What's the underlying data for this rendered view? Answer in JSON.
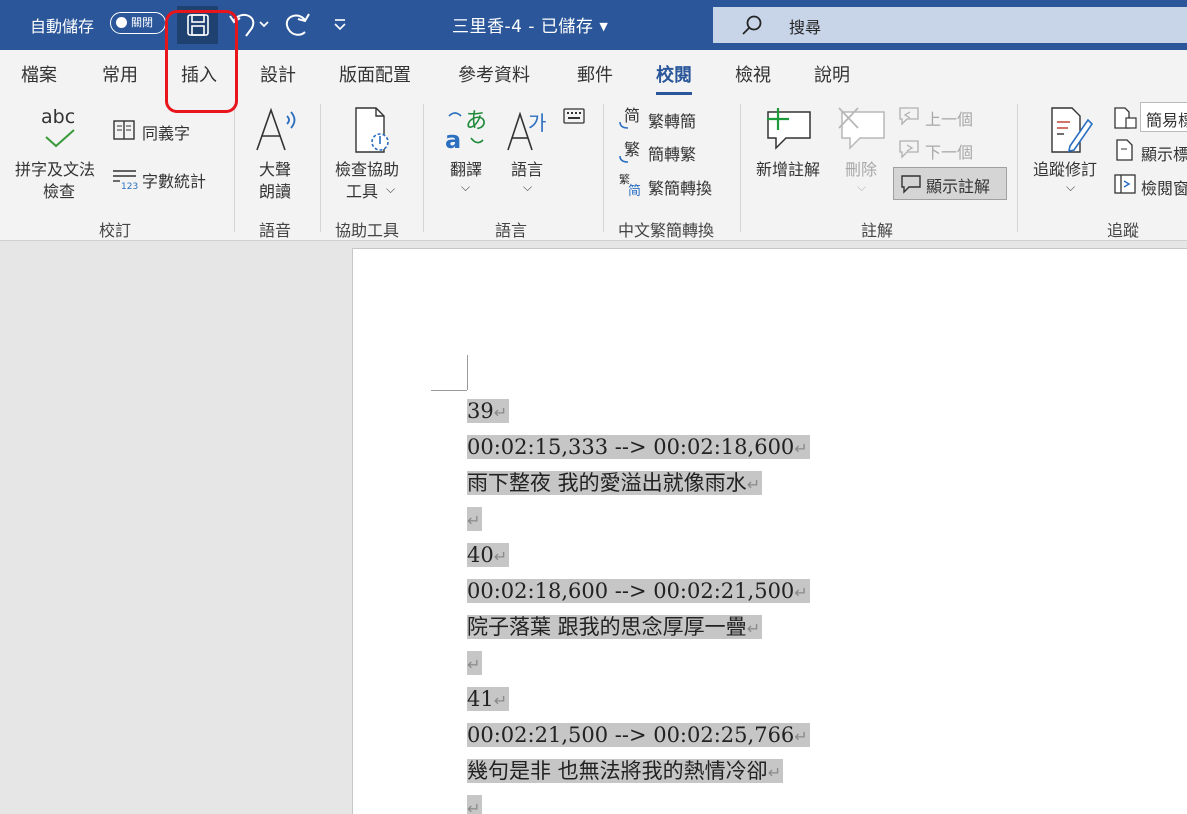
{
  "titlebar": {
    "autosave_label": "自動儲存",
    "autosave_state": "關閉",
    "doc_title": "三里香-4 - 已儲存",
    "search_placeholder": "搜尋"
  },
  "tabs": [
    {
      "label": "檔案"
    },
    {
      "label": "常用"
    },
    {
      "label": "插入"
    },
    {
      "label": "設計"
    },
    {
      "label": "版面配置"
    },
    {
      "label": "參考資料"
    },
    {
      "label": "郵件"
    },
    {
      "label": "校閱",
      "active": true
    },
    {
      "label": "檢視"
    },
    {
      "label": "說明"
    }
  ],
  "ribbon": {
    "proofing": {
      "spelling_line1": "拼字及文法",
      "spelling_line2": "檢查",
      "thesaurus": "同義字",
      "wordcount": "字數統計",
      "group": "校訂",
      "abc": "abc"
    },
    "speech": {
      "read_line1": "大聲",
      "read_line2": "朗讀",
      "group": "語音"
    },
    "accessibility": {
      "check_line1": "檢查協助",
      "check_line2": "工具",
      "group": "協助工具"
    },
    "language": {
      "translate": "翻譯",
      "language": "語言",
      "group": "語言"
    },
    "chinese": {
      "to_simplified": "繁轉簡",
      "to_traditional": "簡轉繁",
      "convert": "繁簡轉換",
      "group": "中文繁簡轉換"
    },
    "comments": {
      "new": "新增註解",
      "delete": "刪除",
      "previous": "上一個",
      "next": "下一個",
      "show": "顯示註解",
      "group": "註解"
    },
    "tracking": {
      "track": "追蹤修訂",
      "markup": "簡易標",
      "show_markup": "顯示標",
      "reviewing_pane": "檢閱窗",
      "group": "追蹤"
    }
  },
  "document": {
    "lines": [
      {
        "text": "39",
        "kind": "num"
      },
      {
        "text": "00:02:15,333 --> 00:02:18,600",
        "kind": "time"
      },
      {
        "text": "雨下整夜 我的愛溢出就像雨水",
        "kind": "lyric"
      },
      {
        "text": "",
        "kind": "blank"
      },
      {
        "text": "40",
        "kind": "num"
      },
      {
        "text": "00:02:18,600 --> 00:02:21,500",
        "kind": "time"
      },
      {
        "text": "院子落葉 跟我的思念厚厚一疊",
        "kind": "lyric"
      },
      {
        "text": "",
        "kind": "blank"
      },
      {
        "text": "41",
        "kind": "num"
      },
      {
        "text": "00:02:21,500 --> 00:02:25,766",
        "kind": "time"
      },
      {
        "text": "幾句是非 也無法將我的熱情冷卻",
        "kind": "lyric"
      },
      {
        "text": "",
        "kind": "blank"
      }
    ],
    "paragraph_mark": "↵"
  }
}
